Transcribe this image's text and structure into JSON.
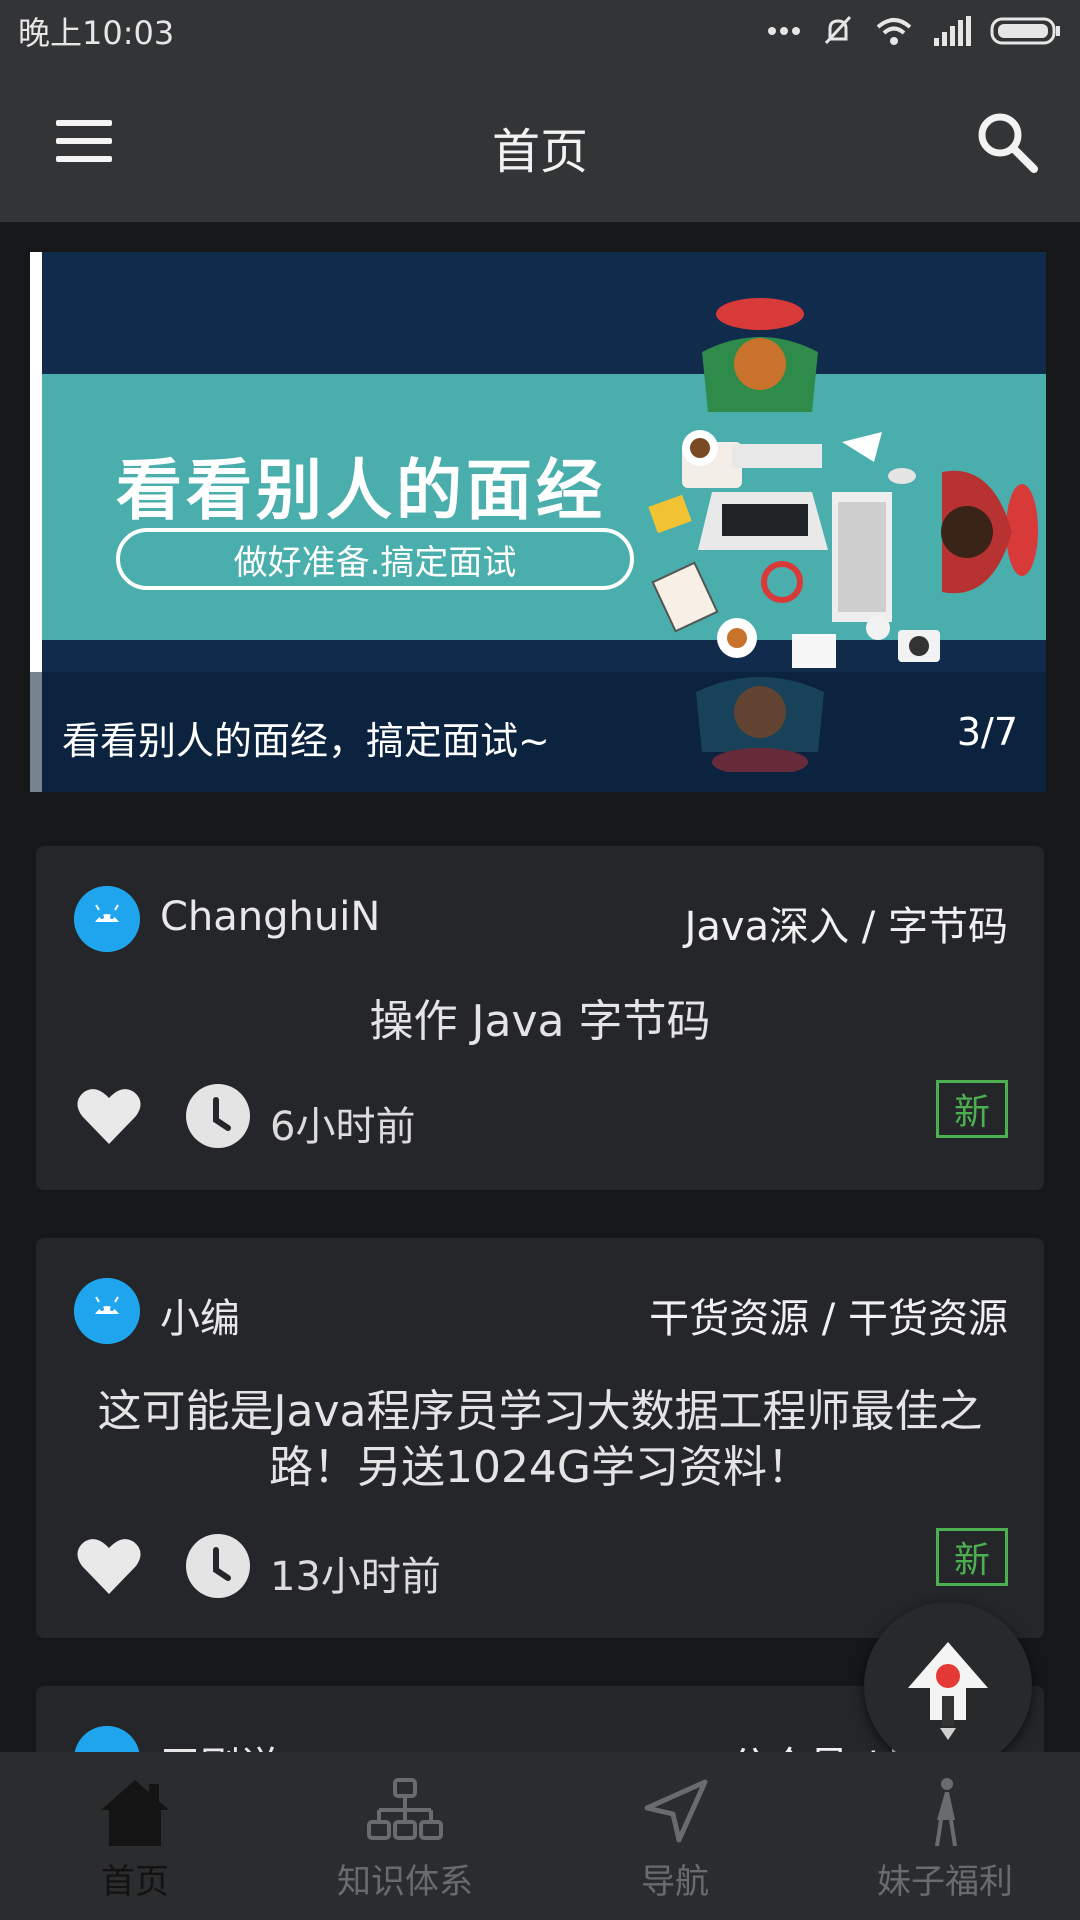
{
  "status_bar": {
    "time": "晚上10:03"
  },
  "app_bar": {
    "title": "首页"
  },
  "banner": {
    "heading": "看看别人的面经",
    "subheading": "做好准备.搞定面试",
    "caption": "看看别人的面经，搞定面试~",
    "index": "3/7"
  },
  "articles": [
    {
      "author": "ChanghuiN",
      "category": "Java深入 / 字节码",
      "title": "操作 Java 字节码",
      "time": "6小时前",
      "tag": "新"
    },
    {
      "author": "小编",
      "category": "干货资源 / 干货资源",
      "title": "这可能是Java程序员学习大数据工程师最佳之路！另送1024G学习资料！",
      "time": "13小时前",
      "tag": "新"
    },
    {
      "author": "玉刚说",
      "category": "公众号 / 玉刚说"
    }
  ],
  "bottom_nav": {
    "items": [
      {
        "label": "首页",
        "icon": "home-icon",
        "active": true
      },
      {
        "label": "知识体系",
        "icon": "hierarchy-icon",
        "active": false
      },
      {
        "label": "导航",
        "icon": "navigation-arrow-icon",
        "active": false
      },
      {
        "label": "妹子福利",
        "icon": "girl-icon",
        "active": false
      }
    ]
  },
  "colors": {
    "background": "#161718",
    "bar": "#333435",
    "card": "#252629",
    "accent_new": "#4caf50",
    "avatar": "#1ea5ee"
  }
}
